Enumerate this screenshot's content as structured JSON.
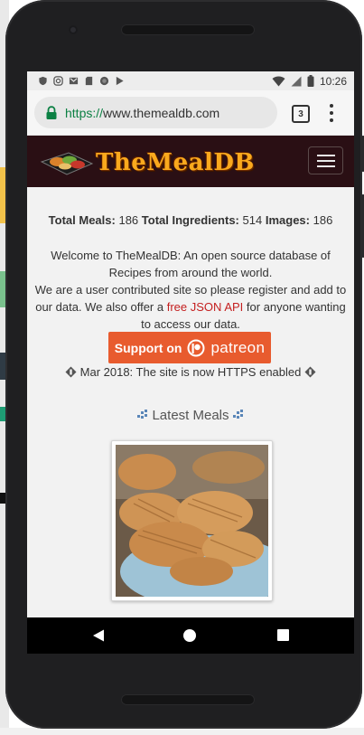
{
  "status_bar": {
    "time": "10:26",
    "icons": [
      "shield-icon",
      "instagram-icon",
      "gmail-icon",
      "sd-card-icon",
      "record-icon",
      "play-store-icon",
      "wifi-icon",
      "signal-icon",
      "battery-icon"
    ]
  },
  "browser": {
    "url_scheme": "https://",
    "url_host": "www.themealdb.com",
    "tab_count": "3"
  },
  "site": {
    "logo_text": "TheMealDB",
    "stats": {
      "meals_label": "Total Meals:",
      "meals_value": "186",
      "ingredients_label": "Total Ingredients:",
      "ingredients_value": "514",
      "images_label": "Images:",
      "images_value": "186"
    },
    "welcome_line1": "Welcome to TheMealDB: An open source database of Recipes from around the world.",
    "welcome_line2_start": "We are a user contributed site so please register and add to our data. We also offer a",
    "api_link": "free JSON API",
    "welcome_line2_end": "for anyone wanting to access our data.",
    "patreon_label": "Support on",
    "patreon_brand": "patreon",
    "notice": "Mar 2018: The site is now HTTPS enabled",
    "latest_heading": "Latest Meals"
  },
  "colors": {
    "header_bg": "#2a0f14",
    "logo_color": "#f9a91d",
    "link": "#c41f1f",
    "patreon": "#e85b2e",
    "url_scheme": "#0b8043"
  }
}
